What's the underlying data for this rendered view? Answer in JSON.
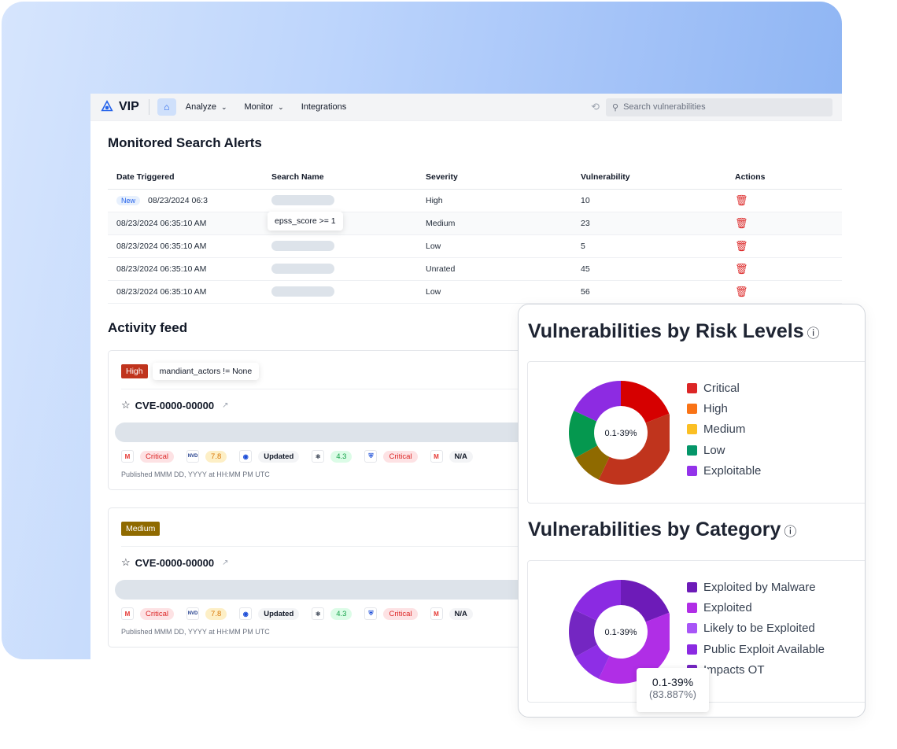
{
  "app": {
    "logo": "VIP",
    "nav": [
      "Analyze",
      "Monitor",
      "Integrations"
    ],
    "search_placeholder": "Search vulnerabilities"
  },
  "alerts": {
    "title": "Monitored Search Alerts",
    "columns": [
      "Date Triggered",
      "Search Name",
      "Severity",
      "Vulnerability",
      "Actions"
    ],
    "new_badge": "New",
    "rows": [
      {
        "date": "08/23/2024 06:3",
        "severity": "High",
        "vulnerability": "10",
        "is_new": true
      },
      {
        "date": "08/23/2024 06:35:10 AM",
        "severity": "Medium",
        "vulnerability": "23"
      },
      {
        "date": "08/23/2024 06:35:10 AM",
        "severity": "Low",
        "vulnerability": "5"
      },
      {
        "date": "08/23/2024 06:35:10 AM",
        "severity": "Unrated",
        "vulnerability": "45"
      },
      {
        "date": "08/23/2024 06:35:10 AM",
        "severity": "Low",
        "vulnerability": "56"
      }
    ],
    "tooltip": "epss_score >= 1"
  },
  "feed": {
    "title": "Activity feed",
    "items": [
      {
        "severity": "High",
        "severity_color": "#c0341d",
        "query": "mandiant_actors != None",
        "cve": "CVE-0000-00000",
        "sources": [
          {
            "icon": "mandiant-icon",
            "badge": "Critical"
          },
          {
            "icon": "nvd-icon",
            "label": "NVD",
            "badge": "7.8"
          },
          {
            "icon": "cisa-icon",
            "badge": "Updated"
          },
          {
            "icon": "atom-icon",
            "badge": "4.3"
          },
          {
            "icon": "metasploit-icon",
            "badge": "Critical"
          },
          {
            "icon": "mandiant-icon",
            "badge": "N/A"
          }
        ],
        "published": "Published  MMM DD, YYYY at HH:MM PM UTC"
      },
      {
        "severity": "Medium",
        "severity_color": "#8f6a00",
        "cve": "CVE-0000-00000",
        "sources": [
          {
            "icon": "mandiant-icon",
            "badge": "Critical"
          },
          {
            "icon": "nvd-icon",
            "label": "NVD",
            "badge": "7.8"
          },
          {
            "icon": "cisa-icon",
            "badge": "Updated"
          },
          {
            "icon": "atom-icon",
            "badge": "4.3"
          },
          {
            "icon": "metasploit-icon",
            "badge": "Critical"
          },
          {
            "icon": "mandiant-icon",
            "badge": "N/A"
          }
        ],
        "published": "Published  MMM DD, YYYY at HH:MM PM UTC"
      }
    ]
  },
  "chart_data": [
    {
      "type": "pie",
      "title": "Vulnerabilities by Risk Levels",
      "center_label": "0.1-39%",
      "legend": [
        {
          "name": "Critical",
          "color": "#dc2626"
        },
        {
          "name": "High",
          "color": "#f97316"
        },
        {
          "name": "Medium",
          "color": "#fbbf24"
        },
        {
          "name": "Low",
          "color": "#059669"
        },
        {
          "name": "Exploitable",
          "color": "#9333ea"
        }
      ],
      "slices": [
        {
          "value": 19,
          "color": "#d60000"
        },
        {
          "value": 38,
          "color": "#c0341d"
        },
        {
          "value": 10,
          "color": "#8f6a00"
        },
        {
          "value": 15,
          "color": "#05984f"
        },
        {
          "value": 18,
          "color": "#8d2be2"
        }
      ],
      "legend_position": "right"
    },
    {
      "type": "pie",
      "title": "Vulnerabilities by Category",
      "center_label": "0.1-39%",
      "legend": [
        {
          "name": "Exploited by Malware",
          "color": "#6d1bb8"
        },
        {
          "name": "Exploited",
          "color": "#b02ee6"
        },
        {
          "name": "Likely to be Exploited",
          "color": "#a855f7"
        },
        {
          "name": "Public Exploit Available",
          "color": "#8b2ae2"
        },
        {
          "name": "Impacts OT",
          "color": "#7426c2"
        }
      ],
      "slices": [
        {
          "value": 19,
          "color": "#6d1bb8"
        },
        {
          "value": 38,
          "color": "#b02ee6"
        },
        {
          "value": 10,
          "color": "#8e2ee6"
        },
        {
          "value": 15,
          "color": "#7426c2"
        },
        {
          "value": 18,
          "color": "#8b2ae2"
        }
      ],
      "tooltip": {
        "label": "0.1-39%",
        "value": "(83.887%)"
      },
      "legend_position": "right"
    }
  ]
}
